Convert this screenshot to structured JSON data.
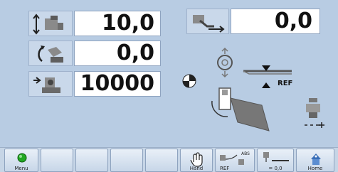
{
  "rows": [
    {
      "icon": "vertical-height-icon",
      "value": "10,0"
    },
    {
      "icon": "rotation-icon",
      "value": "0,0"
    },
    {
      "icon": "count-icon",
      "value": "10000"
    }
  ],
  "motion": {
    "icon": "horizontal-move-icon",
    "value": "0,0"
  },
  "diagram": {
    "ref_label": "REF"
  },
  "toolbar": {
    "buttons": [
      {
        "label": "Menu",
        "icon": "menu-circle-icon"
      },
      {
        "label": "",
        "icon": ""
      },
      {
        "label": "",
        "icon": ""
      },
      {
        "label": "",
        "icon": ""
      },
      {
        "label": "",
        "icon": ""
      },
      {
        "label": "Hand",
        "icon": "hand-icon"
      },
      {
        "label": "REF",
        "icon": "ref-abs-icon",
        "sub_label": "ABS"
      },
      {
        "label": "= 0,0",
        "icon": "zero-ref-icon"
      },
      {
        "label": "Home",
        "icon": "home-icon"
      }
    ]
  },
  "colors": {
    "background": "#b8cce3",
    "field": "#ffffff",
    "accent": "#1a8a1a"
  }
}
